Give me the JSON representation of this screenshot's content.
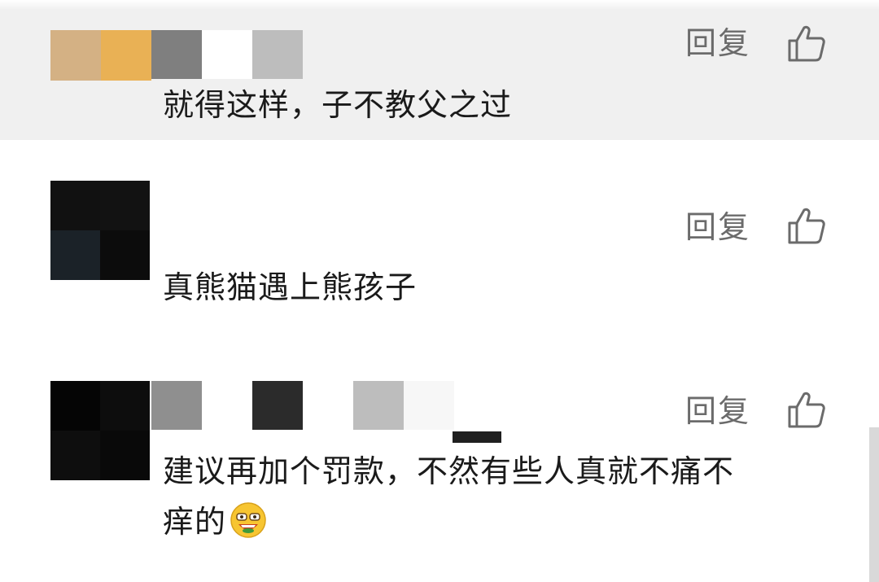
{
  "comments": [
    {
      "text": "就得这样，子不教父之过",
      "reply_label": "回复",
      "like_icon": "thumbs-up-icon",
      "avatar_colors": [
        "#d4b184",
        "#e9b155",
        "#7f7f7f",
        "#ffffff"
      ],
      "name_colors": [
        "#ffffff",
        "#bdbdbd"
      ]
    },
    {
      "text": "真熊猫遇上熊孩子",
      "reply_label": "回复",
      "like_icon": "thumbs-up-icon",
      "avatar_colors": [
        "#111111",
        "#121212",
        "#1b2228",
        "#0c0c0c"
      ],
      "name_colors": []
    },
    {
      "text": "建议再加个罚款，不然有些人真就不痛不痒的",
      "text_line1": "建议再加个罚款，不然有些人真就不痛不",
      "text_line2": "痒的",
      "emoji_icon": "grinning-face-emoji-icon",
      "reply_label": "回复",
      "like_icon": "thumbs-up-icon",
      "avatar_colors": [
        "#050505",
        "#0d0d0d",
        "#0e0e0e",
        "#090909"
      ],
      "name_colors": [
        "#8f8f8f",
        "#ffffff",
        "#2b2b2b",
        "#ffffff",
        "#bdbdbd",
        "#f7f7f7",
        "#1f1f1f"
      ]
    }
  ]
}
